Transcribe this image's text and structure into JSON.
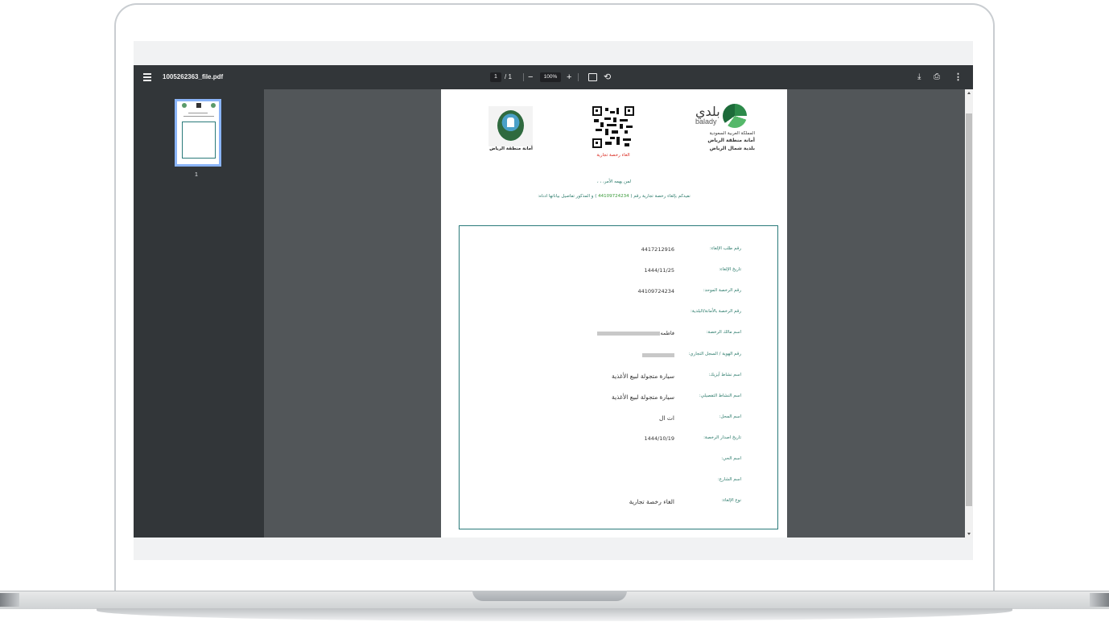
{
  "toolbar": {
    "filename": "1005262363_file.pdf",
    "current_page": "1",
    "total_pages": "/ 1",
    "zoom_minus": "−",
    "zoom_level": "100%",
    "zoom_plus": "+",
    "rotate_glyph": "⟲",
    "download_glyph": "⤓",
    "print_glyph": "⎙",
    "more_glyph": "⋮"
  },
  "thumbnails": [
    {
      "page_number": "1",
      "selected": true
    }
  ],
  "document": {
    "amanah_caption": "أمانة منطقة الرياض",
    "qr_caption": "الغاء رخصة تجارية",
    "balady_word": "بلدي",
    "balady_latin": "balady",
    "org": {
      "line1": "المملكة العربية السعودية",
      "line2": "أمانة منطقة الرياض",
      "line3": "بلدية شمال الرياض"
    },
    "greeting": "لمن يهمه الأمر، ، ،",
    "notify_prefix": "نفيدكم بإلغاء رخصة تجارية رقم (",
    "notify_number": "44109724234",
    "notify_suffix": ") و المذكور تفاصيل بياناتها ادناه:",
    "fields": [
      {
        "label": "رقم طلب الإلغاء:",
        "value": "4417212916"
      },
      {
        "label": "تاريخ الإلغاء:",
        "value": "1444/11/25"
      },
      {
        "label": "رقم الرخصة الموحد:",
        "value": "44109724234"
      },
      {
        "label": "رقم الرخصة بالأمانة/البلدية:",
        "value": ""
      },
      {
        "label": "اسم مالك الرخصة:",
        "value": "فاطمه"
      },
      {
        "label": "رقم الهوية / السجل التجاري:",
        "value": ""
      },
      {
        "label": "اسم نشاط آيزيك:",
        "value": "سيارة متجولة لبيع الأغذية"
      },
      {
        "label": "اسم النشاط التفصيلي:",
        "value": "سيارة متجولة لبيع الأغذية"
      },
      {
        "label": "اسم المحل:",
        "value": "ات ال"
      },
      {
        "label": "تاريخ اصدار الرخصة:",
        "value": "1444/10/19"
      },
      {
        "label": "اسم الحي:",
        "value": ""
      },
      {
        "label": "اسم الشارع:",
        "value": ""
      },
      {
        "label": "نوع الإلغاء:",
        "value": "الغاء رخصة تجارية"
      }
    ]
  },
  "colors": {
    "toolbar_bg": "#323639",
    "viewer_bg": "#525659",
    "accent_teal": "#2a7a7a",
    "caption_red": "#d9261c",
    "thumb_selected": "#8ab4f8"
  }
}
